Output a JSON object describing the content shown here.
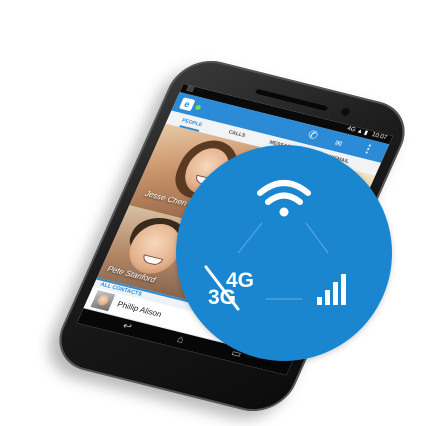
{
  "status_bar": {
    "network": "4G",
    "time": "10:07"
  },
  "app": {
    "logo": "e"
  },
  "tabs": [
    "PEOPLE",
    "CALLS",
    "MESSAGES",
    "VOICEMAIL"
  ],
  "contacts": {
    "featured": [
      "Jesse Chen",
      "Pete Stanford"
    ],
    "section_label": "ALL CONTACTS",
    "list": [
      "Phillip Alison"
    ]
  },
  "badge": {
    "label_4g": "4G",
    "label_3g": "3G",
    "icons": [
      "wifi-icon",
      "signal-bars-icon",
      "disabled-cellular-icon"
    ],
    "color": "#1b86d0"
  },
  "colors": {
    "accent": "#2c8bd6",
    "status_green": "#7bd94a"
  }
}
